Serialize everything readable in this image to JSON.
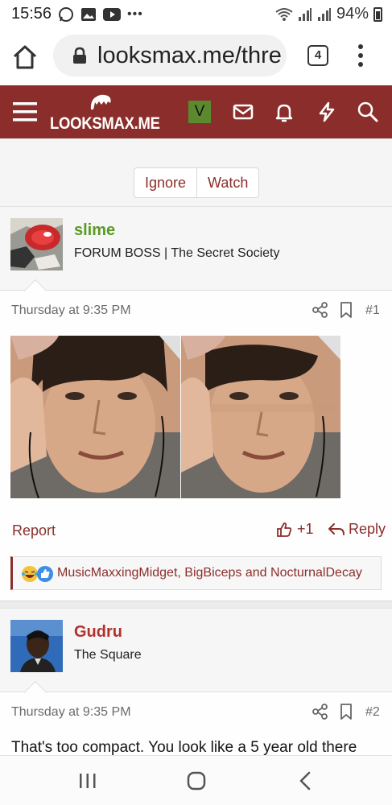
{
  "status_bar": {
    "time": "15:56",
    "battery": "94%"
  },
  "browser": {
    "url": "looksmax.me/thre",
    "tab_count": "4"
  },
  "site": {
    "logo_text": "LOOKSMAX.ME",
    "user_initial": "V",
    "brand_color": "#8b2e2b"
  },
  "thread_header": {
    "ghost_text": "slime   Thursday at 9:35 PM",
    "ignore_label": "Ignore",
    "watch_label": "Watch"
  },
  "posts": [
    {
      "username": "slime",
      "username_color": "#5a9a24",
      "user_title": "FORUM BOSS | The Secret Society",
      "timestamp": "Thursday at 9:35 PM",
      "post_number": "#1",
      "report_label": "Report",
      "like_label": "+1",
      "reply_label": "Reply",
      "reactions_text": "MusicMaxxingMidget, BigBiceps and NocturnalDecay"
    },
    {
      "username": "Gudru",
      "username_color": "#b3312c",
      "user_title": "The Square",
      "timestamp": "Thursday at 9:35 PM",
      "post_number": "#2",
      "body_text": "That's too compact. You look like a 5 year old there"
    }
  ]
}
